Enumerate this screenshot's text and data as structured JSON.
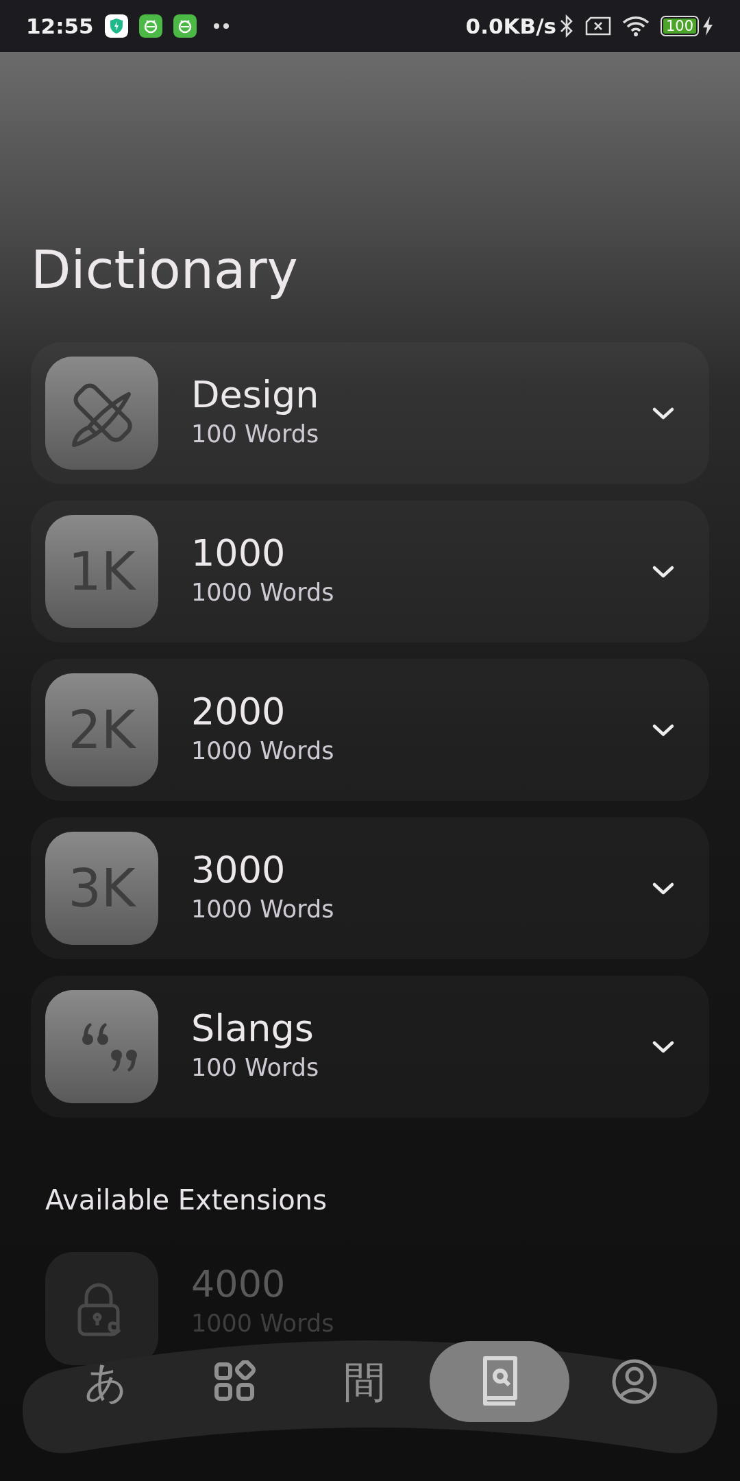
{
  "status_bar": {
    "time": "12:55",
    "net_speed": "0.0KB/s",
    "battery": "100"
  },
  "title": "Dictionary",
  "dictionaries": [
    {
      "kind": "design",
      "title": "Design",
      "count": "100 Words",
      "expanded": false
    },
    {
      "kind": "text",
      "icon_text": "1K",
      "title": "1000",
      "count": "1000 Words",
      "expanded": false
    },
    {
      "kind": "text",
      "icon_text": "2K",
      "title": "2000",
      "count": "1000 Words",
      "expanded": false
    },
    {
      "kind": "text",
      "icon_text": "3K",
      "title": "3000",
      "count": "1000 Words",
      "expanded": false
    },
    {
      "kind": "quote",
      "title": "Slangs",
      "count": "100 Words",
      "expanded": false
    }
  ],
  "extensions_heading": "Available Extensions",
  "extensions": [
    {
      "title": "4000",
      "count": "1000 Words",
      "locked": true
    }
  ],
  "bottom_nav": [
    {
      "kind": "glyph",
      "glyph": "あ",
      "selected": false
    },
    {
      "kind": "grid",
      "selected": false
    },
    {
      "kind": "glyph",
      "glyph": "間",
      "selected": false
    },
    {
      "kind": "book",
      "selected": true
    },
    {
      "kind": "profile",
      "selected": false
    }
  ]
}
